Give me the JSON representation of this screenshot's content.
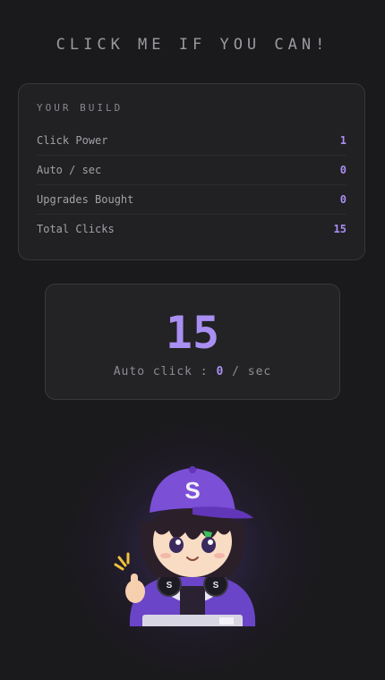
{
  "header": {
    "title": "CLICK ME IF YOU CAN!"
  },
  "build": {
    "heading": "YOUR BUILD",
    "stats": [
      {
        "label": "Click Power",
        "value": "1"
      },
      {
        "label": "Auto / sec",
        "value": "0"
      },
      {
        "label": "Upgrades Bought",
        "value": "0"
      },
      {
        "label": "Total Clicks",
        "value": "15"
      }
    ]
  },
  "counter": {
    "value": "15",
    "auto_prefix": "Auto click : ",
    "auto_value": "0",
    "auto_suffix": " / sec"
  },
  "mascot": {
    "cap_letter": "S",
    "icon": "chibi-boy-clicker-mascot"
  },
  "colors": {
    "accent": "#a98ff2",
    "background": "#1a191b",
    "card": "#212022"
  }
}
